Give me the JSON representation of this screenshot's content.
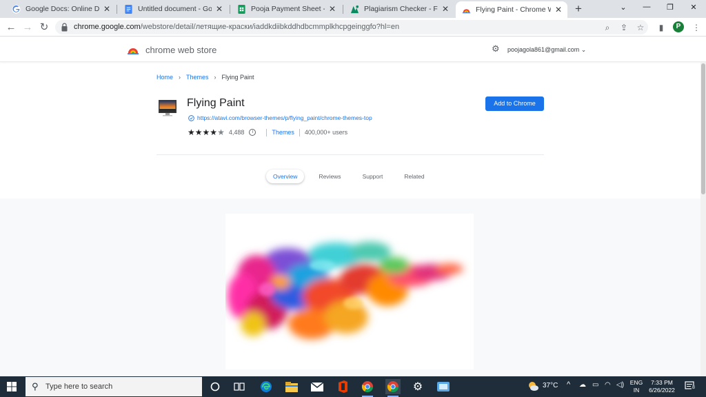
{
  "browser": {
    "tabs": [
      {
        "title": "Google Docs: Online Docume",
        "icon": "google-icon",
        "active": false
      },
      {
        "title": "Untitled document - Google",
        "icon": "docs-icon",
        "active": false
      },
      {
        "title": "Pooja Payment Sheet - Goog",
        "icon": "sheets-icon",
        "active": false
      },
      {
        "title": "Plagiarism Checker - Free &",
        "icon": "plagiarism-icon",
        "active": false
      },
      {
        "title": "Flying Paint - Chrome Web S",
        "icon": "webstore-icon",
        "active": true
      }
    ],
    "url_host": "chrome.google.com",
    "url_path": "/webstore/detail/летящие-краски/iaddkdiibkddhdbcmmplkhcpgeinggfo?hl=en",
    "profile_initial": "P"
  },
  "store": {
    "title": "chrome web store",
    "account": "poojagola861@gmail.com"
  },
  "breadcrumb": {
    "home": "Home",
    "category": "Themes",
    "current": "Flying Paint"
  },
  "item": {
    "title": "Flying Paint",
    "link": "https://atavi.com/browser-themes/p/flying_paint/chrome-themes-top",
    "rating": 4,
    "rating_count": "4,488",
    "category": "Themes",
    "users": "400,000+ users",
    "add_button": "Add to Chrome"
  },
  "page_tabs": [
    {
      "label": "Overview",
      "active": true
    },
    {
      "label": "Reviews",
      "active": false
    },
    {
      "label": "Support",
      "active": false
    },
    {
      "label": "Related",
      "active": false
    }
  ],
  "taskbar": {
    "search_placeholder": "Type here to search",
    "temperature": "37°C",
    "lang_top": "ENG",
    "lang_bottom": "IN",
    "time": "7:33 PM",
    "date": "6/26/2022",
    "notification_count": "8"
  },
  "colors": {
    "accent": "#1a73e8",
    "taskbar": "#1f2d3a",
    "tabstrip": "#dee1e6"
  }
}
